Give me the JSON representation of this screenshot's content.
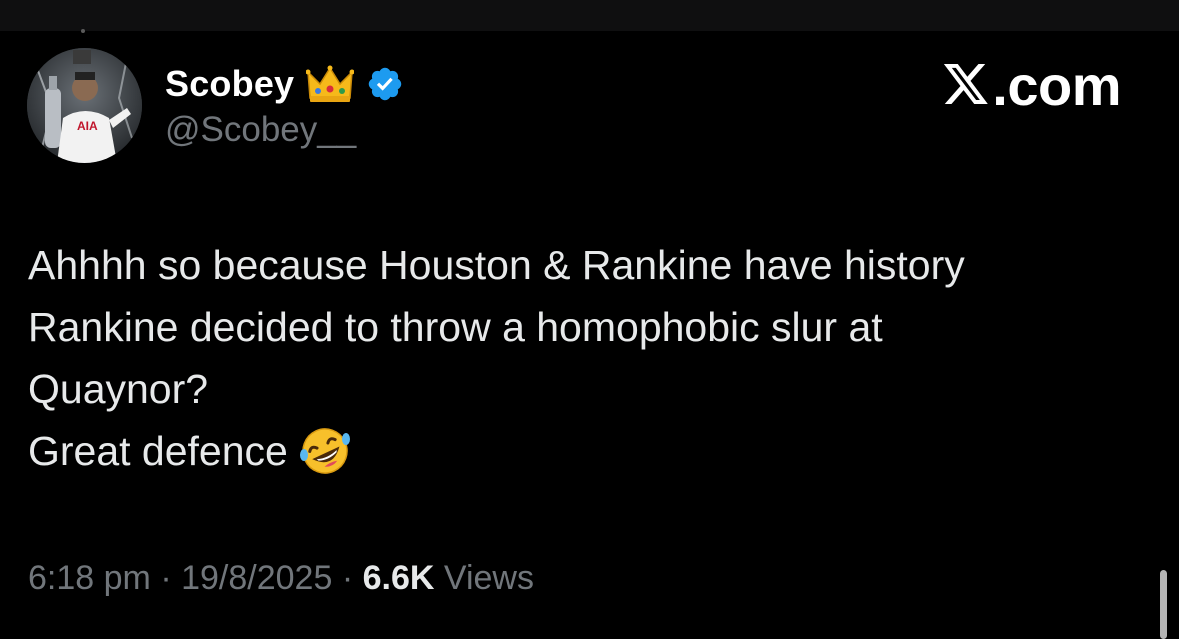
{
  "author": {
    "display_name": "Scobey",
    "handle": "@Scobey__",
    "badge_emoji_icon": "crown-icon",
    "verified_icon": "verified-badge-icon"
  },
  "source": {
    "logo_icon": "x-logo-icon",
    "suffix": ".com"
  },
  "tweet": {
    "lines": [
      "Ahhhh so because Houston & Rankine have history",
      "Rankine decided to throw a homophobic slur at",
      "Quaynor?",
      "Great defence"
    ],
    "trailing_emoji_icon": "rolling-on-floor-laughing-icon"
  },
  "meta": {
    "time": "6:18 pm",
    "date": "19/8/2025",
    "separator": "·",
    "views_count": "6.6K",
    "views_label": "Views"
  },
  "colors": {
    "background": "#000000",
    "text_primary": "#e7e9ea",
    "text_secondary": "#71767b",
    "verified_blue": "#1d9bf0"
  }
}
